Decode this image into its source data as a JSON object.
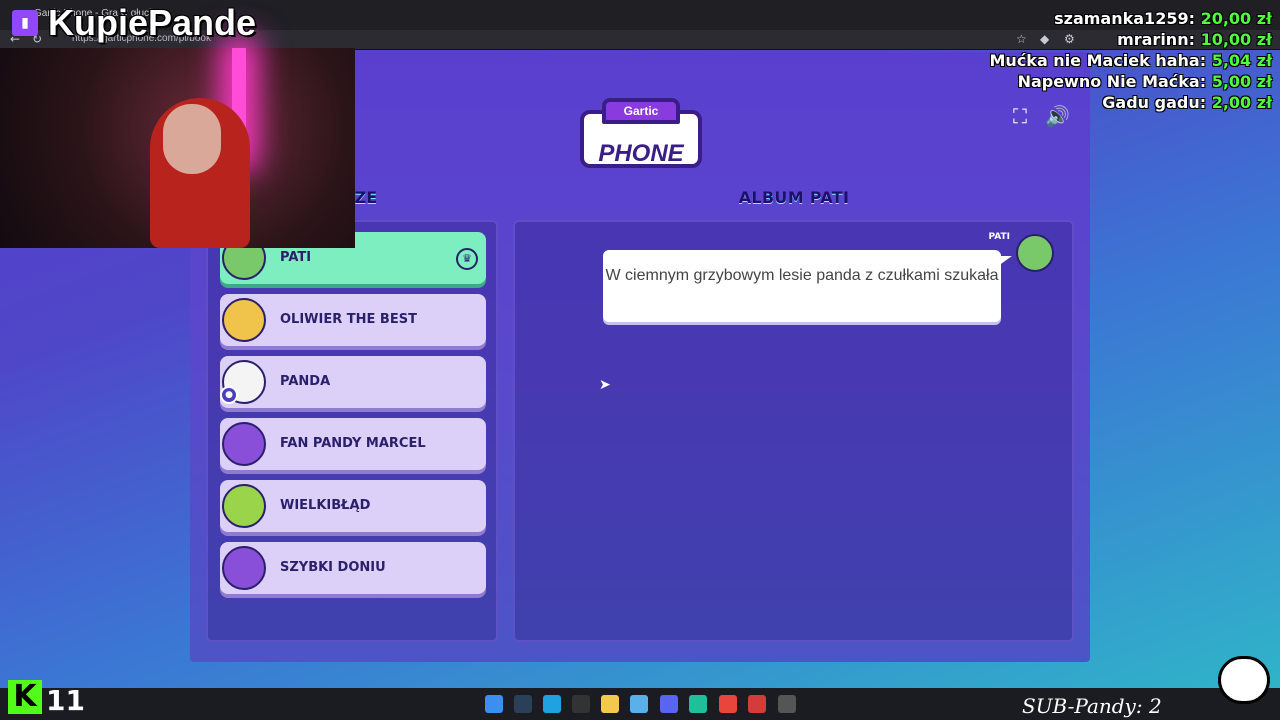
{
  "browser": {
    "tab_title": "Gartic Phone - Gra w głuchy",
    "url": "https://garticphone.com/pl/book"
  },
  "game": {
    "logo_top": "Gartic",
    "logo_main": "PHONE",
    "players_title": "CZE",
    "album_title": "ALBUM PATI",
    "players": [
      {
        "name": "PATI",
        "host": true
      },
      {
        "name": "OLIWIER THE BEST"
      },
      {
        "name": "PANDA",
        "is_self": true
      },
      {
        "name": "FAN PANDY MARCEL"
      },
      {
        "name": "WIELKIBŁĄD"
      },
      {
        "name": "SZYBKI DONIU"
      }
    ],
    "message": {
      "author": "PATI",
      "text": "W ciemnym grzybowym lesie panda z czułkami szukała"
    }
  },
  "stream": {
    "channel": "KupiePande",
    "donations": [
      {
        "name": "szamanka1259:",
        "amount": "20,00 zł"
      },
      {
        "name": "mrarinn:",
        "amount": "10,00 zł"
      },
      {
        "name": "Mućka nie Maciek haha:",
        "amount": "5,04 zł"
      },
      {
        "name": "Napewno Nie Maćka:",
        "amount": "5,00 zł"
      },
      {
        "name": "Gadu gadu:",
        "amount": "2,00 zł"
      }
    ],
    "kick_count": "11",
    "sub_counter": "SUB-Pandy: 2"
  },
  "colors": {
    "host_card": "#7deec0",
    "player_card": "#dccff8",
    "donation_amount": "#4eff3a"
  }
}
